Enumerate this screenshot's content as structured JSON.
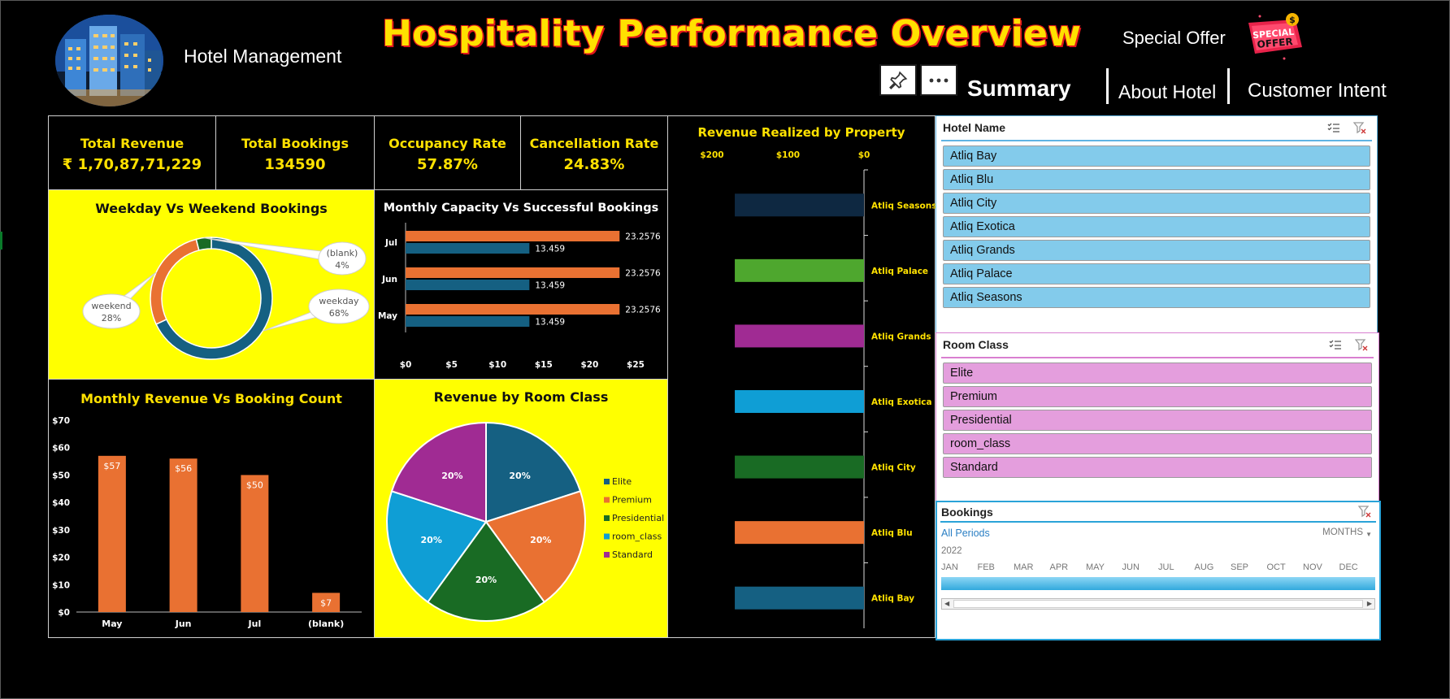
{
  "header": {
    "brand": "Hotel Management",
    "title": "Hospitality Performance Overview",
    "special_offer": "Special Offer",
    "badge_text": [
      "SPECIAL",
      "OFFER"
    ],
    "badge_currency": "$"
  },
  "nav": {
    "summary": "Summary",
    "about": "About Hotel",
    "intent": "Customer Intent"
  },
  "kpis": [
    {
      "label": "Total Revenue",
      "value": "₹ 1,70,87,71,229"
    },
    {
      "label": "Total Bookings",
      "value": "134590"
    },
    {
      "label": "Occupancy Rate",
      "value": "57.87%"
    },
    {
      "label": "Cancellation Rate",
      "value": "24.83%"
    }
  ],
  "colors": {
    "yellow": "#ffff00",
    "orange": "#e97132",
    "blue": "#156082",
    "green": "#196b24",
    "cyan": "#0f9ed5",
    "purple": "#a02b93",
    "lime": "#4ea72e",
    "navy": "#0e2841",
    "hotel_slicer": "#83cbeb",
    "room_slicer": "#e49edd"
  },
  "chart_data": [
    {
      "id": "weekday_weekend",
      "type": "pie",
      "title": "Weekday Vs Weekend Bookings",
      "slices": [
        {
          "name": "weekday",
          "value": 68,
          "label": "68%"
        },
        {
          "name": "weekend",
          "value": 28,
          "label": "28%"
        },
        {
          "name": "(blank)",
          "value": 4,
          "label": "4%"
        }
      ]
    },
    {
      "id": "monthly_capacity",
      "type": "bar",
      "title": "Monthly Capacity Vs Successful Bookings",
      "categories": [
        "Jul",
        "Jun",
        "May"
      ],
      "series": [
        {
          "values": [
            23.2576,
            23.2576,
            23.2576
          ]
        },
        {
          "values": [
            13.459,
            13.459,
            13.459
          ]
        }
      ],
      "xticks": [
        "$0",
        "$5",
        "$10",
        "$15",
        "$20",
        "$25"
      ],
      "xlim": [
        0,
        25
      ]
    },
    {
      "id": "monthly_revenue",
      "type": "bar",
      "title": "Monthly Revenue Vs Booking Count",
      "categories": [
        "May",
        "Jun",
        "Jul",
        "(blank)"
      ],
      "values": [
        57,
        56,
        50,
        7
      ],
      "labels": [
        "$57",
        "$56",
        "$50",
        "$7"
      ],
      "yticks": [
        "$0",
        "$10",
        "$20",
        "$30",
        "$40",
        "$50",
        "$60",
        "$70"
      ],
      "ylim": [
        0,
        70
      ]
    },
    {
      "id": "room_class",
      "type": "pie",
      "title": "Revenue by Room Class",
      "slices": [
        {
          "name": "Elite",
          "value": 20,
          "label": "20%"
        },
        {
          "name": "Premium",
          "value": 20,
          "label": "20%"
        },
        {
          "name": "Presidential",
          "value": 20,
          "label": "20%"
        },
        {
          "name": "room_class",
          "value": 20,
          "label": "20%"
        },
        {
          "name": "Standard",
          "value": 20,
          "label": "20%"
        }
      ],
      "legend_position": "right"
    },
    {
      "id": "revenue_property",
      "type": "bar",
      "title": "Revenue Realized by Property",
      "categories": [
        "Atliq Seasons",
        "Atliq Palace",
        "Atliq Grands",
        "Atliq Exotica",
        "Atliq City",
        "Atliq Blu",
        "Atliq Bay"
      ],
      "values": [
        170,
        170,
        170,
        170,
        170,
        170,
        170
      ],
      "xticks": [
        "$200",
        "$100",
        "$0"
      ],
      "xlim": [
        200,
        0
      ],
      "orientation": "horizontal-reversed"
    }
  ],
  "slicers": {
    "hotel": {
      "title": "Hotel Name",
      "items": [
        "Atliq Bay",
        "Atliq Blu",
        "Atliq City",
        "Atliq Exotica",
        "Atliq Grands",
        "Atliq Palace",
        "Atliq Seasons"
      ]
    },
    "room": {
      "title": "Room Class",
      "items": [
        "Elite",
        "Premium",
        "Presidential",
        "room_class",
        "Standard"
      ]
    },
    "bookings": {
      "title": "Bookings",
      "period": "All Periods",
      "unit": "MONTHS",
      "year": "2022",
      "months": [
        "JAN",
        "FEB",
        "MAR",
        "APR",
        "MAY",
        "JUN",
        "JUL",
        "AUG",
        "SEP",
        "OCT",
        "NOV",
        "DEC"
      ]
    }
  }
}
